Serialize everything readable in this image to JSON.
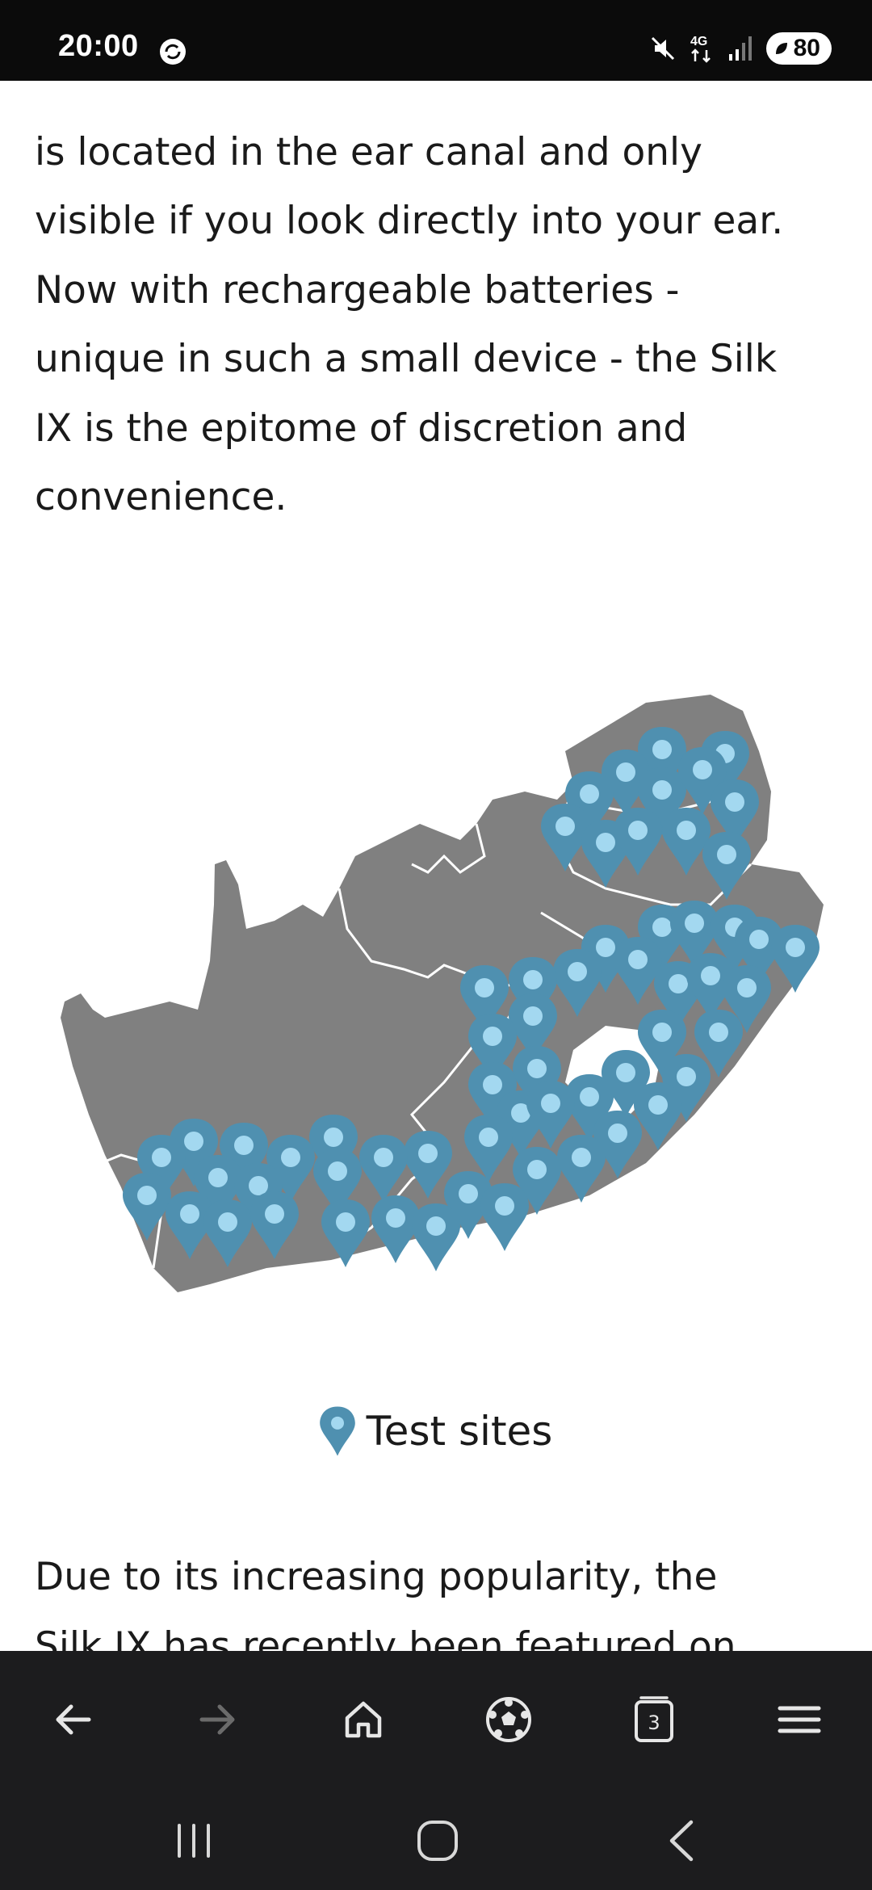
{
  "status_bar": {
    "time": "20:00",
    "network": "4G",
    "battery": "80",
    "icons": [
      "sync-icon",
      "mute-icon",
      "network-4g-icon",
      "signal-icon",
      "battery-icon"
    ]
  },
  "article": {
    "paragraph_top_lines": [
      "is located in the ear canal and only",
      "visible if you look directly into your ear.",
      "Now with rechargeable batteries -",
      "unique in such a small device - the Silk",
      "IX is the epitome of discretion and",
      "convenience."
    ],
    "legend_label": "Test sites",
    "paragraph_bottom_lines": [
      "Due to its increasing popularity, the",
      "Silk IX has recently been featured on"
    ]
  },
  "map": {
    "land_color": "#808080",
    "border_color": "#ffffff",
    "marker_color": "#4f90b0",
    "marker_dot_color": "#a3d8f0"
  },
  "browser_toolbar": {
    "tabs_count": "3",
    "icons": [
      "back-arrow-icon",
      "forward-arrow-icon",
      "home-icon",
      "soccer-ball-icon",
      "tabs-icon",
      "menu-icon"
    ]
  },
  "system_nav": {
    "icons": [
      "recent-apps-icon",
      "home-circle-icon",
      "back-chevron-icon"
    ]
  }
}
